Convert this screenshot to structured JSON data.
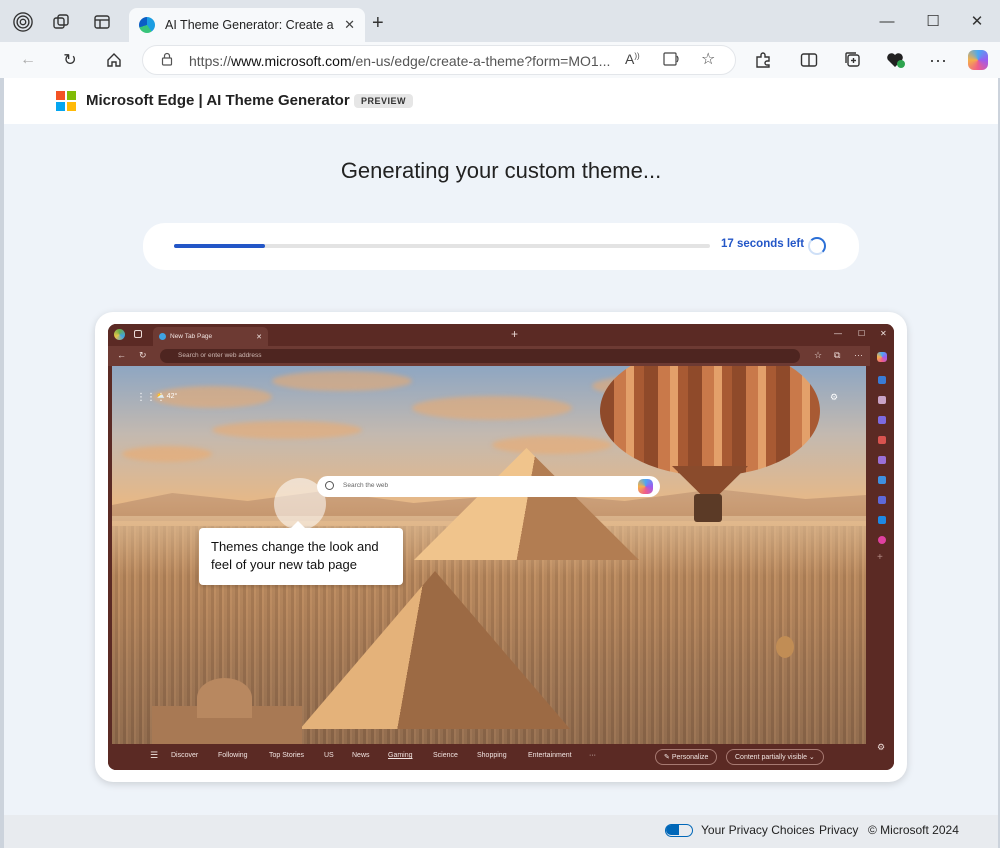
{
  "browser": {
    "tab_title": "AI Theme Generator: Create a Cu",
    "tab_close": "✕",
    "new_tab": "+",
    "url_prefix": "https://",
    "url_host": "www.microsoft.com",
    "url_path": "/en-us/edge/create-a-theme?form=MO1...",
    "window_controls": [
      "—",
      "☐",
      "✕"
    ]
  },
  "site": {
    "title": "Microsoft Edge | AI Theme Generator",
    "badge": "PREVIEW"
  },
  "main": {
    "heading": "Generating your custom theme...",
    "progress_fraction": 0.17,
    "progress_text": "17 seconds left"
  },
  "preview": {
    "tab_title": "New Tab Page",
    "address_placeholder": "Search or enter web address",
    "weather": "42°",
    "search_placeholder": "Search the web",
    "tooltip": "Themes change the look and feel of your new tab page",
    "feed_items": [
      "Discover",
      "Following",
      "Top Stories",
      "US",
      "News",
      "Gaming",
      "Science",
      "Shopping",
      "Entertainment",
      "···"
    ],
    "active_feed": "Gaming",
    "personalize": "Personalize",
    "content_visibility": "Content partially visible"
  },
  "footer": {
    "privacy_choices": "Your Privacy Choices",
    "privacy": "Privacy",
    "copyright": "© Microsoft 2024"
  },
  "colors": {
    "accent": "#2356c7",
    "theme_frame": "#5b2a24"
  }
}
